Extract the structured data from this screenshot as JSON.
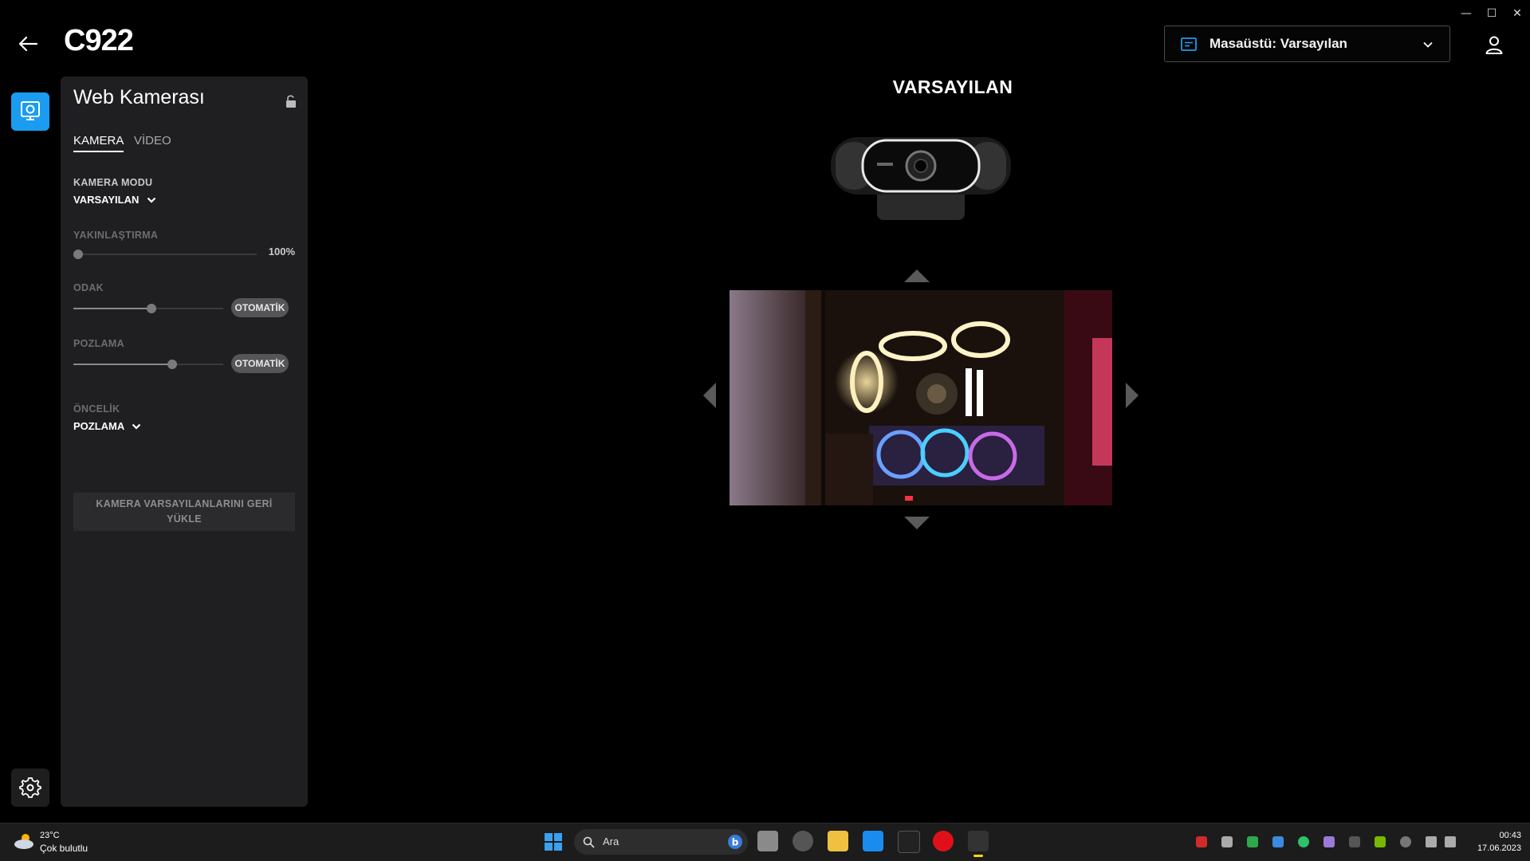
{
  "window": {
    "minimize": "—",
    "maximize": "☐",
    "close": "✕"
  },
  "header": {
    "title": "C922",
    "profile_label": "Masaüstü: Varsayılan"
  },
  "panel": {
    "title": "Web Kamerası",
    "tabs": [
      {
        "label": "KAMERA",
        "active": true
      },
      {
        "label": "VİDEO",
        "active": false
      }
    ],
    "camera_mode": {
      "label": "KAMERA MODU",
      "value": "VARSAYILAN"
    },
    "zoom": {
      "label": "YAKINLAŞTIRMA",
      "value_text": "100%",
      "level": 0
    },
    "focus": {
      "label": "ODAK",
      "level": 0.52,
      "auto_label": "OTOMATİK"
    },
    "exposure": {
      "label": "POZLAMA",
      "level": 0.66,
      "auto_label": "OTOMATİK"
    },
    "priority": {
      "label": "ÖNCELİK",
      "value": "POZLAMA"
    },
    "reset_line1": "KAMERA VARSAYILANLARINI GERİ",
    "reset_line2": "YÜKLE"
  },
  "main": {
    "mode_title": "VARSAYILAN"
  },
  "taskbar": {
    "weather_temp": "23°C",
    "weather_desc": "Çok bulutlu",
    "search_placeholder": "Ara",
    "time": "00:43",
    "date": "17.06.2023"
  },
  "colors": {
    "accent": "#1a9cf0",
    "panel_bg": "#1f1f22",
    "pill_bg": "#555558"
  }
}
